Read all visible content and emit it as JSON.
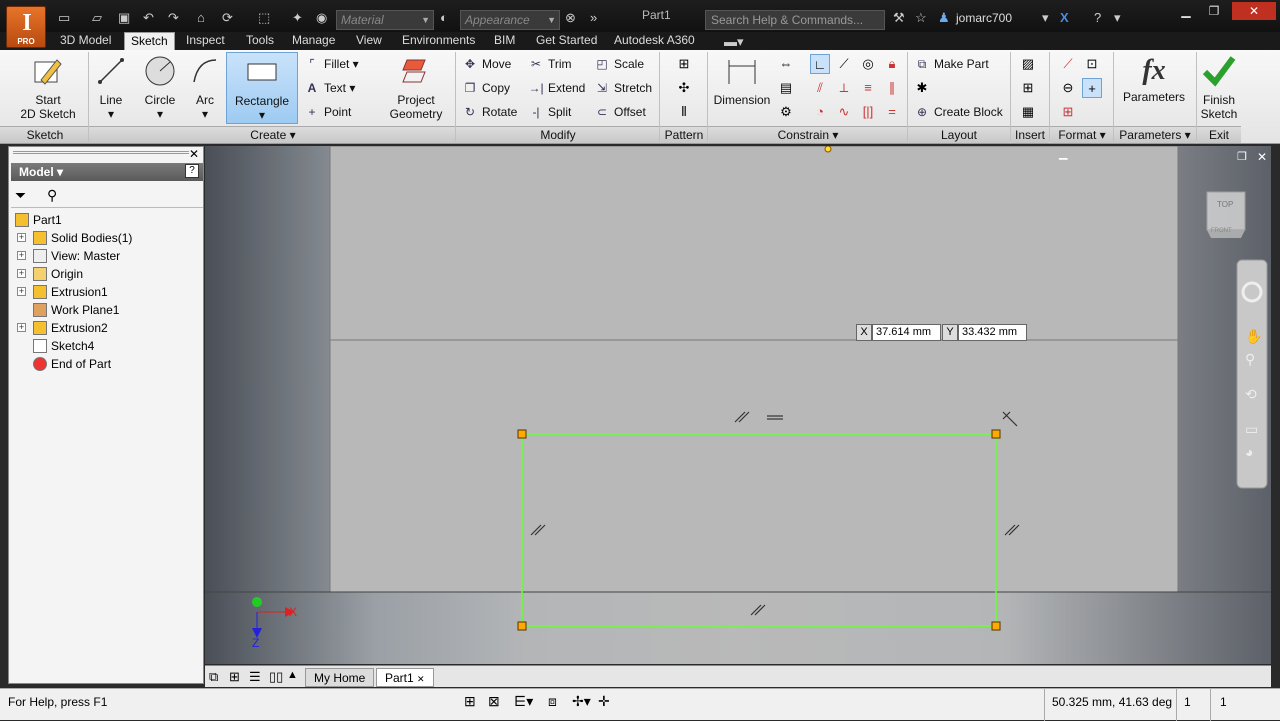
{
  "app": {
    "document_title": "Part1",
    "material_placeholder": "Material",
    "appearance_placeholder": "Appearance",
    "search_placeholder": "Search Help & Commands...",
    "user_name": "jomarc700",
    "badge": "PRO"
  },
  "ribbon_tabs": [
    "3D Model",
    "Sketch",
    "Inspect",
    "Tools",
    "Manage",
    "View",
    "Environments",
    "BIM",
    "Get Started",
    "Autodesk A360"
  ],
  "active_tab": "Sketch",
  "ribbon": {
    "sketch_panel": {
      "label": "Sketch",
      "start": "Start\n2D Sketch"
    },
    "create_panel": {
      "label": "Create",
      "line": "Line",
      "circle": "Circle",
      "arc": "Arc",
      "rectangle": "Rectangle",
      "fillet": "Fillet",
      "text": "Text",
      "point": "Point",
      "project": "Project\nGeometry"
    },
    "modify_panel": {
      "label": "Modify",
      "move": "Move",
      "copy": "Copy",
      "rotate": "Rotate",
      "trim": "Trim",
      "extend": "Extend",
      "split": "Split",
      "scale": "Scale",
      "stretch": "Stretch",
      "offset": "Offset"
    },
    "pattern_panel": {
      "label": "Pattern"
    },
    "constrain_panel": {
      "label": "Constrain",
      "dimension": "Dimension"
    },
    "layout_panel": {
      "label": "Layout",
      "make_part": "Make Part",
      "create_block": "Create Block"
    },
    "insert_panel": {
      "label": "Insert"
    },
    "format_panel": {
      "label": "Format"
    },
    "parameters_panel": {
      "label": "Parameters",
      "parameters": "Parameters"
    },
    "exit_panel": {
      "label": "Exit",
      "finish": "Finish\nSketch"
    }
  },
  "browser": {
    "title": "Model",
    "nodes": [
      {
        "label": "Part1",
        "expandable": false
      },
      {
        "label": "Solid Bodies(1)",
        "expandable": true
      },
      {
        "label": "View: Master",
        "expandable": true
      },
      {
        "label": "Origin",
        "expandable": true
      },
      {
        "label": "Extrusion1",
        "expandable": true
      },
      {
        "label": "Work Plane1",
        "expandable": false
      },
      {
        "label": "Extrusion2",
        "expandable": true
      },
      {
        "label": "Sketch4",
        "expandable": false
      },
      {
        "label": "End of Part",
        "expandable": false
      }
    ]
  },
  "viewport": {
    "x_label": "X",
    "x_value": "37.614 mm",
    "y_label": "Y",
    "y_value": "33.432 mm",
    "viewcube_top": "TOP",
    "viewcube_front": "FRONT",
    "axis_x": "X",
    "axis_z": "Z"
  },
  "document_tabs": [
    "My Home",
    "Part1"
  ],
  "status": {
    "help": "For Help, press F1",
    "measure": "50.325 mm, 41.63 deg",
    "count1": "1",
    "count2": "1"
  },
  "colors": {
    "sketch_line": "#66ff33",
    "handle": "#ffaa00",
    "active_tab_bg": "#f0f0f0"
  }
}
